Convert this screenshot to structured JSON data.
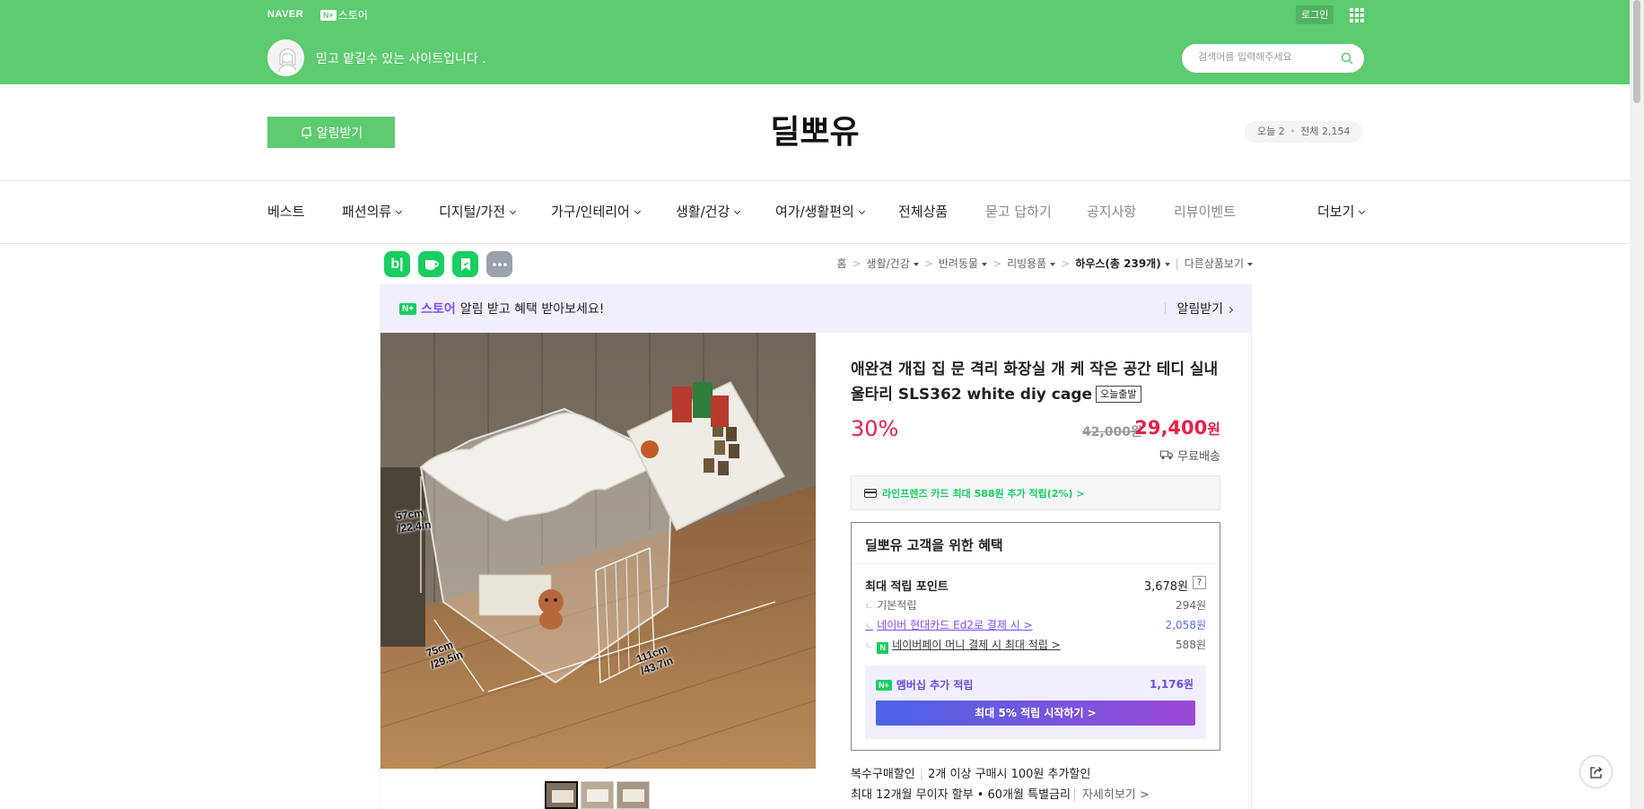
{
  "gnb": {
    "naver_logo": "NAVER",
    "nplus_badge": "N+",
    "nplus_store": "스토어",
    "login_label": "로그인",
    "tagline": "믿고 맡길수 있는 사이트입니다 .",
    "search_placeholder": "검색어를 입력해주세요"
  },
  "store_header": {
    "alarm_label": "알림받기",
    "store_title": "딜뽀유",
    "visit_today": "오늘 2",
    "visit_total": "전체 2,154"
  },
  "nav": {
    "items": [
      {
        "label": "베스트"
      },
      {
        "label": "패션의류"
      },
      {
        "label": "디지털/가전"
      },
      {
        "label": "가구/인테리어"
      },
      {
        "label": "생활/건강"
      },
      {
        "label": "여가/생활편의"
      },
      {
        "label": "전체상품"
      },
      {
        "label": "묻고 답하기"
      },
      {
        "label": "공지사항"
      },
      {
        "label": "리뷰이벤트"
      },
      {
        "label": "더보기"
      }
    ]
  },
  "share_icons": [
    "blog-icon",
    "cafe-icon",
    "bookmark-icon",
    "more-icon"
  ],
  "share_blog_glyph": "b|",
  "breadcrumb": {
    "home": "홈",
    "items": [
      "생활/건강",
      "반려동물",
      "리빙용품",
      "하우스(총 239개)",
      "다른상품보기"
    ]
  },
  "promo": {
    "badge": "N+",
    "store": "스토어",
    "text": "알림 받고 혜택 받아보세요!",
    "cta": "알림받기"
  },
  "image_labels": {
    "height": "57cm /22.4in",
    "width": "75cm /29.5in",
    "length": "111cm /43.7in"
  },
  "product": {
    "title": "애완견 개집 집 문 격리 화장실 개 케 작은 공간 테디 실내 울타리 SLS362 white diy cage",
    "badge_today": "오늘출발",
    "discount": "30%",
    "original_price": "42,000원",
    "sale_price": "29,400",
    "sale_unit": "원",
    "delivery": "무료배송",
    "card_benefit": "라인프렌즈 카드 최대 588원 추가 적립(2%) >"
  },
  "benefit": {
    "title": "딜뽀유 고객을 위한 혜택",
    "max_points_label": "최대 적립 포인트",
    "max_points_value": "3,678원",
    "help": "?",
    "rows": [
      {
        "label": "기본적립",
        "value": "294원"
      },
      {
        "label": "네이버 현대카드 Ed2로 결제 시 >",
        "value": "2,058원"
      },
      {
        "label": "네이버페이 머니 결제 시 최대 적립 >",
        "value": "588원"
      }
    ],
    "npay_glyph": "N",
    "membership_badge": "N+",
    "membership_label": "멤버십 추가 적립",
    "membership_value": "1,176원",
    "membership_button": "최대 5% 적립 시작하기 >"
  },
  "extra": {
    "bulk_label": "복수구매할인",
    "bulk_text": "2개 이상 구매시 100원 추가할인",
    "install_text": "최대 12개월 무이자 할부 • 60개월 특별금리",
    "install_more": "자세히보기 >"
  },
  "colors": {
    "brand_green": "#5dcb6f",
    "price_red": "#e6204a",
    "purple": "#7c4dff"
  }
}
